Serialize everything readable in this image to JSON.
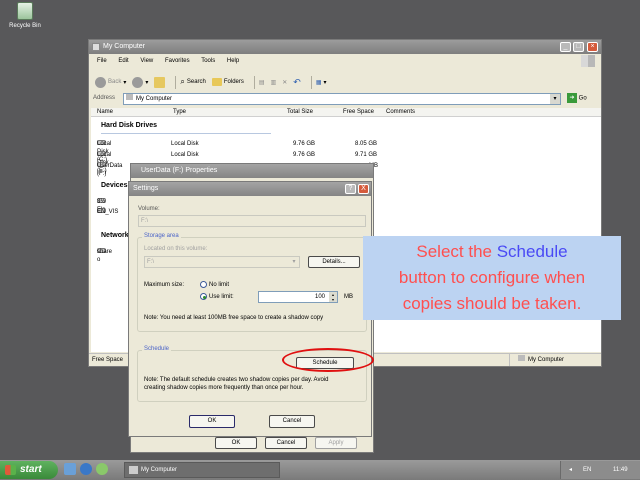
{
  "desktop": {
    "recycle_bin": "Recycle Bin"
  },
  "explorer": {
    "title": "My Computer",
    "menu": [
      "File",
      "Edit",
      "View",
      "Favorites",
      "Tools",
      "Help"
    ],
    "toolbar": {
      "back": "Back",
      "search": "Search",
      "folders": "Folders"
    },
    "address_label": "Address",
    "address_value": "My Computer",
    "go_label": "Go",
    "columns": {
      "name": "Name",
      "type": "Type",
      "total": "Total Size",
      "free": "Free Space",
      "comments": "Comments"
    },
    "group_hdd": "Hard Disk Drives",
    "drives": [
      {
        "name": "Local Disk (C:)",
        "type": "Local Disk",
        "total": "9.76 GB",
        "free": "8.05 GB"
      },
      {
        "name": "Local Disk (E:)",
        "type": "Local Disk",
        "total": "9.76 GB",
        "free": "9.71 GB"
      },
      {
        "name": "UserData (F:)",
        "free": "MB"
      }
    ],
    "group_devices": "Devices",
    "devices": [
      "3½ Flo",
      "EN_VIS"
    ],
    "group_network": "Network",
    "network": [
      "share o"
    ],
    "status_left": "Free Space",
    "status_right": "My Computer"
  },
  "props": {
    "title": "UserData (F:) Properties",
    "ok": "OK",
    "cancel": "Cancel",
    "apply": "Apply"
  },
  "settings": {
    "title": "Settings",
    "volume_label": "Volume:",
    "volume_value": "F:\\",
    "storage_legend": "Storage area",
    "located_label": "Located on this volume:",
    "located_value": "F:\\",
    "details_btn": "Details...",
    "max_size_label": "Maximum size:",
    "no_limit": "No limit",
    "use_limit": "Use limit:",
    "limit_value": "100",
    "limit_unit": "MB",
    "note1": "Note: You need at least 100MB free space to create a shadow copy",
    "schedule_legend": "Schedule",
    "schedule_btn": "Schedule",
    "note2_line1": "Note: The default schedule creates two shadow copies per day. Avoid",
    "note2_line2": "creating shadow copies more frequently than once per hour.",
    "ok": "OK",
    "cancel": "Cancel",
    "help": "?",
    "close": "X"
  },
  "callout": {
    "line1_a": "Select the ",
    "line1_b": "Schedule",
    "line2": "button to configure when",
    "line3": "copies should be taken."
  },
  "taskbar": {
    "start": "start",
    "task": "My Computer",
    "lang": "EN",
    "clock": "11:49"
  },
  "colors": {
    "callout_bg": "#bcd3f2",
    "callout_text": "#ff4f4f",
    "callout_highlight": "#4a4af5",
    "highlight_ring": "#e01010"
  }
}
